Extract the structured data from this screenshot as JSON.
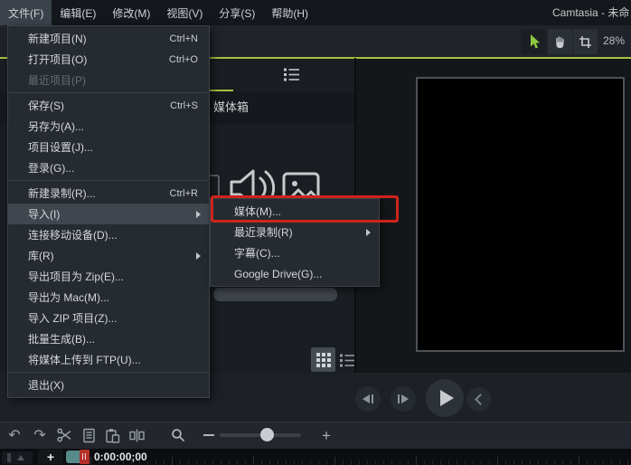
{
  "window": {
    "title": "Camtasia - 未命"
  },
  "menubar": {
    "items": [
      {
        "name": "file",
        "label": "文件(F)",
        "active": true
      },
      {
        "name": "edit",
        "label": "编辑(E)"
      },
      {
        "name": "modify",
        "label": "修改(M)"
      },
      {
        "name": "view",
        "label": "视图(V)"
      },
      {
        "name": "share",
        "label": "分享(S)"
      },
      {
        "name": "help",
        "label": "帮助(H)"
      }
    ]
  },
  "top_toolbar": {
    "zoom_percent": "28%",
    "tools": [
      "selection-tool",
      "pan-tool",
      "crop-tool"
    ],
    "selected_tool": "selection-tool"
  },
  "file_menu": {
    "items": [
      {
        "name": "new-project",
        "label": "新建项目(N)",
        "shortcut": "Ctrl+N"
      },
      {
        "name": "open-project",
        "label": "打开项目(O)",
        "shortcut": "Ctrl+O"
      },
      {
        "name": "recent-projects",
        "label": "最近项目(P)",
        "disabled": true
      },
      {
        "type": "separator"
      },
      {
        "name": "save",
        "label": "保存(S)",
        "shortcut": "Ctrl+S"
      },
      {
        "name": "save-as",
        "label": "另存为(A)..."
      },
      {
        "name": "project-settings",
        "label": "项目设置(J)..."
      },
      {
        "name": "sign-in",
        "label": "登录(G)..."
      },
      {
        "type": "separator"
      },
      {
        "name": "new-recording",
        "label": "新建录制(R)...",
        "shortcut": "Ctrl+R"
      },
      {
        "name": "import",
        "label": "导入(I)",
        "submenu": true,
        "highlighted": true
      },
      {
        "name": "connect-mobile-device",
        "label": "连接移动设备(D)..."
      },
      {
        "name": "library",
        "label": "库(R)",
        "submenu": true
      },
      {
        "name": "export-project-as-zip",
        "label": "导出项目为 Zip(E)..."
      },
      {
        "name": "export-for-mac",
        "label": "导出为 Mac(M)..."
      },
      {
        "name": "import-zip-project",
        "label": "导入 ZIP 项目(Z)..."
      },
      {
        "name": "batch-production",
        "label": "批量生成(B)..."
      },
      {
        "name": "upload-media-to-ftp",
        "label": "将媒体上传到 FTP(U)..."
      },
      {
        "type": "separator"
      },
      {
        "name": "exit",
        "label": "退出(X)"
      }
    ]
  },
  "import_submenu": {
    "items": [
      {
        "name": "media",
        "label": "媒体(M)...",
        "annotated": true
      },
      {
        "name": "recent-recordings",
        "label": "最近录制(R)",
        "submenu": true
      },
      {
        "name": "captions",
        "label": "字幕(C)..."
      },
      {
        "name": "google-drive",
        "label": "Google Drive(G)..."
      }
    ]
  },
  "media_panel": {
    "title": "媒体箱"
  },
  "bottom_toolbar": {
    "zoom_out_label": "−",
    "zoom_in_label": "+"
  },
  "timeline": {
    "timestamp": "0:00:00;00",
    "add_track_label": "+"
  },
  "annotation": {
    "type": "highlight-box",
    "target": "媒体(M)...",
    "color": "#ce241c"
  },
  "colors": {
    "accent_green": "#a9bf3e",
    "tool_green": "#8dc63f",
    "annotation_red": "#ce241c",
    "playhead_teal": "#578b8b",
    "playhead_red": "#b5302a",
    "menu_bg": "#262b31",
    "menu_highlight": "#3f464e",
    "canvas": "#000000"
  }
}
